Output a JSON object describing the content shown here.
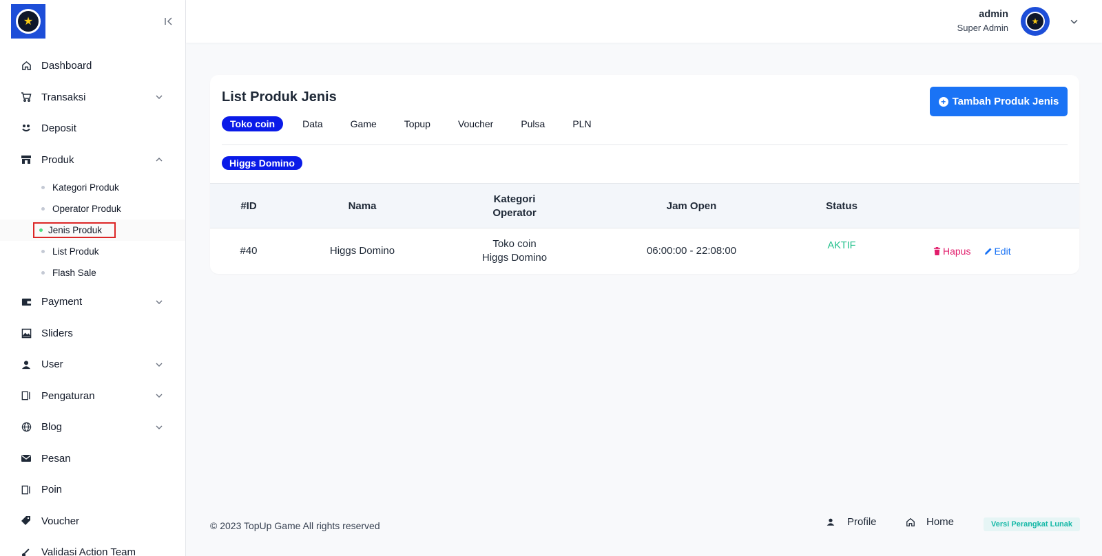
{
  "sidebar": {
    "items": [
      {
        "label": "Dashboard",
        "icon": "home-icon"
      },
      {
        "label": "Transaksi",
        "icon": "cart-icon"
      },
      {
        "label": "Deposit",
        "icon": "deposit-icon"
      },
      {
        "label": "Produk",
        "icon": "store-icon"
      },
      {
        "label": "Payment",
        "icon": "wallet-icon"
      },
      {
        "label": "Sliders",
        "icon": "image-icon"
      },
      {
        "label": "User",
        "icon": "user-icon"
      },
      {
        "label": "Pengaturan",
        "icon": "settings-panel-icon"
      },
      {
        "label": "Blog",
        "icon": "globe-icon"
      },
      {
        "label": "Pesan",
        "icon": "mail-icon"
      },
      {
        "label": "Poin",
        "icon": "panel-icon"
      },
      {
        "label": "Voucher",
        "icon": "tag-icon"
      },
      {
        "label": "Validasi Action Team",
        "icon": "key-icon"
      }
    ],
    "produk_sub": [
      {
        "label": "Kategori Produk"
      },
      {
        "label": "Operator Produk"
      },
      {
        "label": "Jenis Produk"
      },
      {
        "label": "List Produk"
      },
      {
        "label": "Flash Sale"
      }
    ]
  },
  "header": {
    "user_name": "admin",
    "user_role": "Super Admin"
  },
  "card": {
    "title": "List Produk Jenis",
    "add_button": "Tambah Produk Jenis",
    "tabs": [
      "Toko coin",
      "Data",
      "Game",
      "Topup",
      "Voucher",
      "Pulsa",
      "PLN"
    ],
    "active_tab": "Toko coin",
    "filter_pill": "Higgs Domino"
  },
  "table": {
    "headers": {
      "id": "#ID",
      "nama": "Nama",
      "kategori_line1": "Kategori",
      "kategori_line2": "Operator",
      "jam": "Jam Open",
      "status": "Status"
    },
    "rows": [
      {
        "id": "#40",
        "nama": "Higgs Domino",
        "kategori": "Toko coin",
        "operator": "Higgs Domino",
        "jam": "06:00:00 - 22:08:00",
        "status": "AKTIF",
        "delete_label": "Hapus",
        "edit_label": "Edit"
      }
    ]
  },
  "footer": {
    "copyright": "© 2023 TopUp Game All rights reserved",
    "profile_link": "Profile",
    "home_link": "Home",
    "version_badge": "Versi Perangkat Lunak"
  },
  "colors": {
    "primary": "#1a73f5",
    "tab_active": "#0a1be8",
    "status_active": "#22c08b",
    "danger": "#e11d6b"
  }
}
